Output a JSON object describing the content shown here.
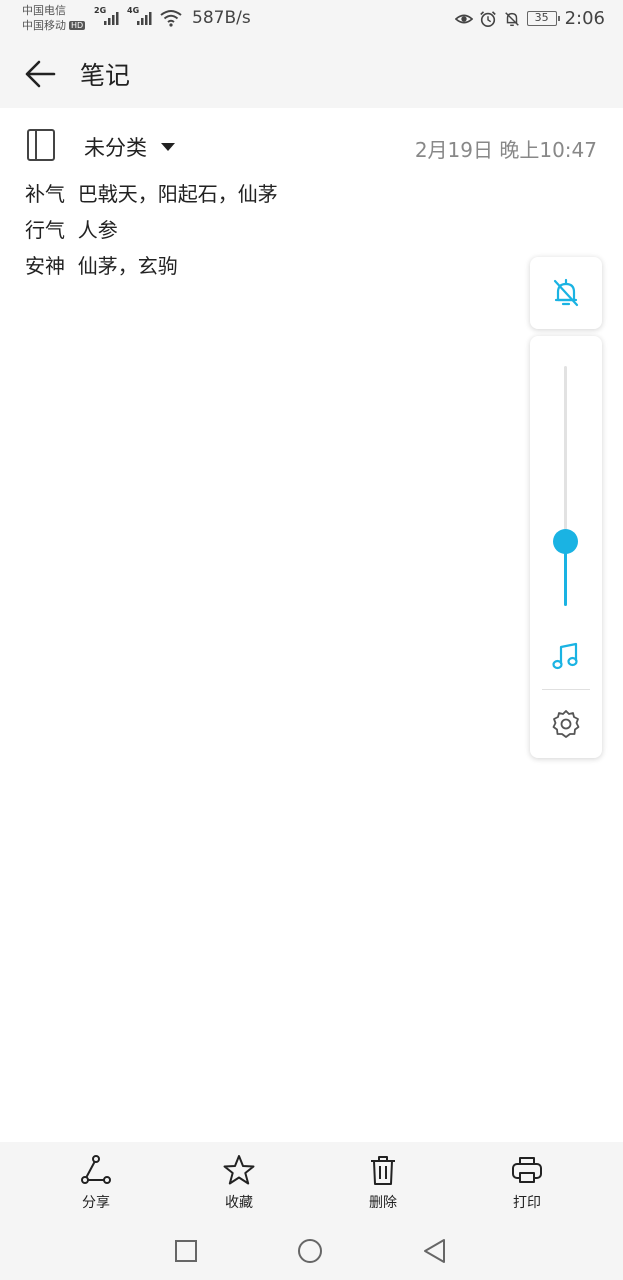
{
  "status_bar": {
    "carrier_1": "中国电信",
    "carrier_2": "中国移动",
    "hd_badge": "HD",
    "signal_1_label": "2G",
    "signal_2_label": "4G",
    "net_speed": "587B/s",
    "battery_level": "35",
    "time": "2:06",
    "icons": [
      "eye-icon",
      "alarm-icon",
      "bell-off-icon",
      "wifi-icon",
      "signal-icon"
    ]
  },
  "header": {
    "title": "笔记"
  },
  "note_meta": {
    "category": "未分类",
    "timestamp": "2月19日 晚上10:47"
  },
  "note": {
    "lines": [
      "补气  巴戟天，阳起石，仙茅",
      "行气  人参",
      "安神  仙茅，玄驹"
    ]
  },
  "volume_panel": {
    "level": 0.27,
    "accent": "#1ab3e3"
  },
  "toolbar": {
    "share_label": "分享",
    "favorite_label": "收藏",
    "delete_label": "删除",
    "print_label": "打印"
  },
  "colors": {
    "bar_bg": "#f5f5f5",
    "accent": "#1ab3e3"
  }
}
